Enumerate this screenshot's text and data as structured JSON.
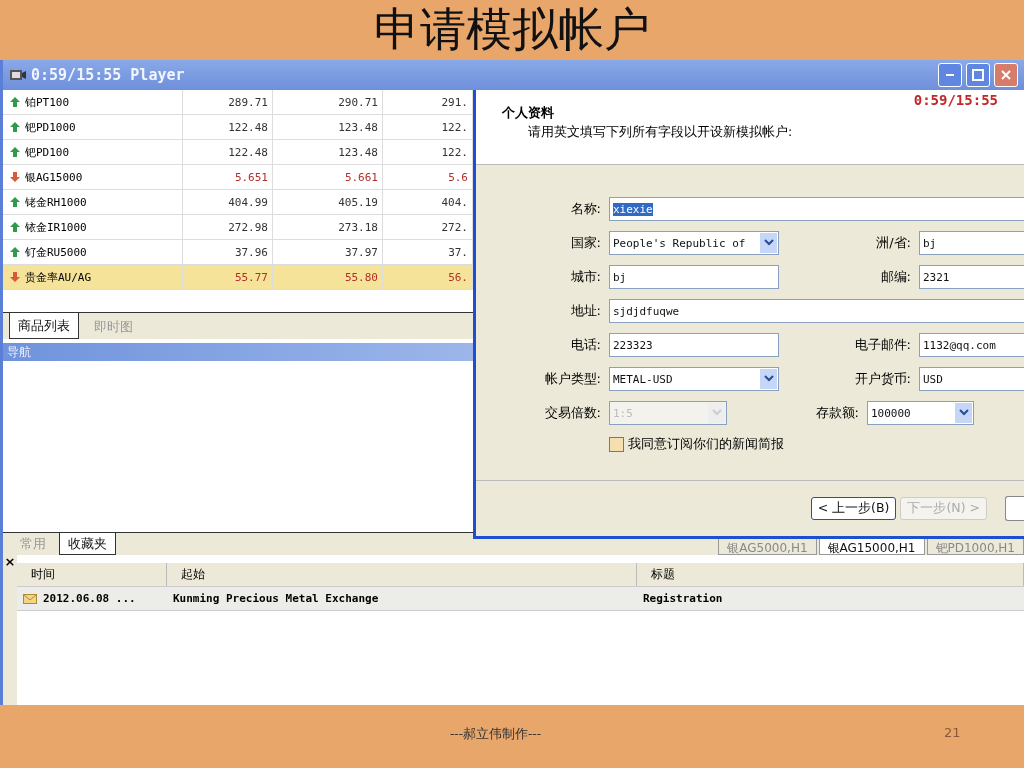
{
  "slide": {
    "title": "申请模拟帐户",
    "footer": "---郝立伟制作---",
    "page_number": "21"
  },
  "window": {
    "title": "0:59/15:55 Player"
  },
  "quotes": [
    {
      "name": "铂PT100",
      "kind": "up",
      "bid": "289.71",
      "ask": "290.71",
      "column_4": "291.",
      "selected": false
    },
    {
      "name": "钯PD1000",
      "kind": "up",
      "bid": "122.48",
      "ask": "123.48",
      "column_4": "122.",
      "selected": false
    },
    {
      "name": "钯PD100",
      "kind": "up",
      "bid": "122.48",
      "ask": "123.48",
      "column_4": "122.",
      "selected": false
    },
    {
      "name": "银AG15000",
      "kind": "down",
      "bid": "5.651",
      "ask": "5.661",
      "column_4": "5.6",
      "selected": false
    },
    {
      "name": "铑金RH1000",
      "kind": "up",
      "bid": "404.99",
      "ask": "405.19",
      "column_4": "404.",
      "selected": false
    },
    {
      "name": "铱金IR1000",
      "kind": "up",
      "bid": "272.98",
      "ask": "273.18",
      "column_4": "272.",
      "selected": false
    },
    {
      "name": "钌金RU5000",
      "kind": "up",
      "bid": "37.96",
      "ask": "37.97",
      "column_4": "37.",
      "selected": false
    },
    {
      "name": "贵金率AU/AG",
      "kind": "down",
      "bid": "55.77",
      "ask": "55.80",
      "column_4": "56.",
      "selected": true
    }
  ],
  "left_tabs": [
    {
      "label": "商品列表",
      "selected": true
    },
    {
      "label": "即时图",
      "selected": false
    }
  ],
  "nav_header": "导航",
  "bottom_tabs": [
    {
      "label": "常用",
      "selected": false
    },
    {
      "label": "收藏夹",
      "selected": true
    }
  ],
  "dialog": {
    "heading": "个人资料",
    "instruction": "请用英文填写下列所有字段以开设新模拟帐户:",
    "timer": "0:59/15:55",
    "rows": [
      {
        "left": {
          "label": "名称:",
          "kind": "wide",
          "value": "xiexie",
          "highlighted": true
        }
      },
      {
        "left": {
          "label": "国家:",
          "kind": "select",
          "value": "People's Republic of ",
          "disabled": false
        },
        "right": {
          "label": "洲/省:",
          "kind": "text",
          "value": "bj"
        }
      },
      {
        "left": {
          "label": "城市:",
          "kind": "text",
          "value": "bj"
        },
        "right": {
          "label": "邮编:",
          "kind": "text",
          "value": "2321"
        }
      },
      {
        "left": {
          "label": "地址:",
          "kind": "wide",
          "value": "sjdjdfuqwe",
          "highlighted": false
        }
      },
      {
        "left": {
          "label": "电话:",
          "kind": "text",
          "value": "223323"
        },
        "right": {
          "label": "电子邮件:",
          "kind": "text",
          "value": "1132@qq.com"
        }
      },
      {
        "left": {
          "label": "帐户类型:",
          "kind": "select",
          "value": "METAL-USD",
          "disabled": false
        },
        "right": {
          "label": "开户货币:",
          "kind": "text",
          "value": "USD"
        }
      },
      {
        "left": {
          "label": "交易倍数:",
          "kind": "select",
          "value": "1:5",
          "disabled": true
        },
        "right": {
          "label": "存款额:",
          "kind": "select",
          "value": "100000",
          "disabled": false
        }
      }
    ],
    "newsletter": {
      "label": "我同意订阅你们的新闻简报",
      "checked": false
    },
    "buttons": [
      {
        "label": "< 上一步(B)",
        "disabled": false
      },
      {
        "label": "下一步(N) >",
        "disabled": true
      }
    ]
  },
  "chart_tabs": [
    {
      "label": "银AG5000,H1",
      "selected": false
    },
    {
      "label": "银AG15000,H1",
      "selected": true
    },
    {
      "label": "钯PD1000,H1",
      "selected": false
    }
  ],
  "messages": {
    "close": "×",
    "columns": [
      "时间",
      "起始",
      "标题"
    ],
    "rows": [
      {
        "time": "2012.06.08 ...",
        "from": "Kunming Precious Metal Exchange",
        "subject": "Registration"
      }
    ]
  }
}
